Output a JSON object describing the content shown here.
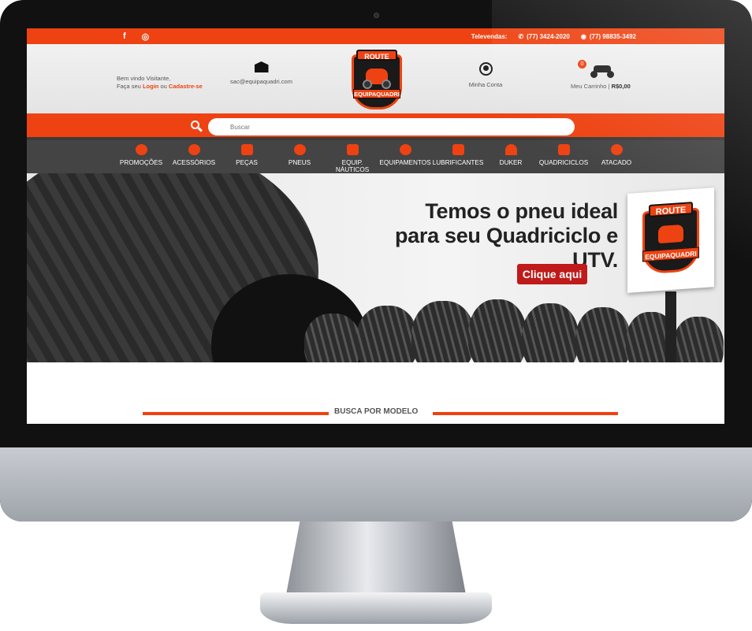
{
  "topbar": {
    "social_icons": [
      "facebook-icon",
      "instagram-icon"
    ],
    "televendas_label": "Televendas:",
    "phone": "(77) 3424-2020",
    "whatsapp": "(77) 98835-3492"
  },
  "header": {
    "welcome_line": "Bem vindo Visitante,",
    "login_prefix": "Faça seu",
    "login_link": "Login",
    "login_or": "ou",
    "register_link": "Cadastre-se",
    "email": "sac@equipaquadri.com",
    "logo_top": "ROUTE",
    "logo_bottom": "EQUIPAQUADRI",
    "account_label": "Minha Conta",
    "cart_count": "0",
    "cart_label": "Meu Carrinho |",
    "cart_total": "R$0,00"
  },
  "search": {
    "placeholder": "Buscar"
  },
  "nav": {
    "items": [
      {
        "label": "PROMOÇÕES"
      },
      {
        "label": "ACESSÓRIOS"
      },
      {
        "label": "PEÇAS"
      },
      {
        "label": "PNEUS"
      },
      {
        "label": "EQUIP. NÁUTICOS"
      },
      {
        "label": "EQUIPAMENTOS"
      },
      {
        "label": "LUBRIFICANTES"
      },
      {
        "label": "DUKER"
      },
      {
        "label": "QUADRICICLOS"
      },
      {
        "label": "ATACADO"
      }
    ]
  },
  "hero": {
    "headline_1": "Temos o pneu ideal",
    "headline_2": "para seu Quadriciclo e UTV.",
    "cta": "Clique aqui",
    "sign_top": "ROUTE",
    "sign_bottom": "EQUIPAQUADRI"
  },
  "section": {
    "model_search_title": "BUSCA POR MODELO"
  },
  "colors": {
    "accent": "#ee4212",
    "nav_bg": "#444444",
    "cta_bg": "#c01a1a"
  }
}
